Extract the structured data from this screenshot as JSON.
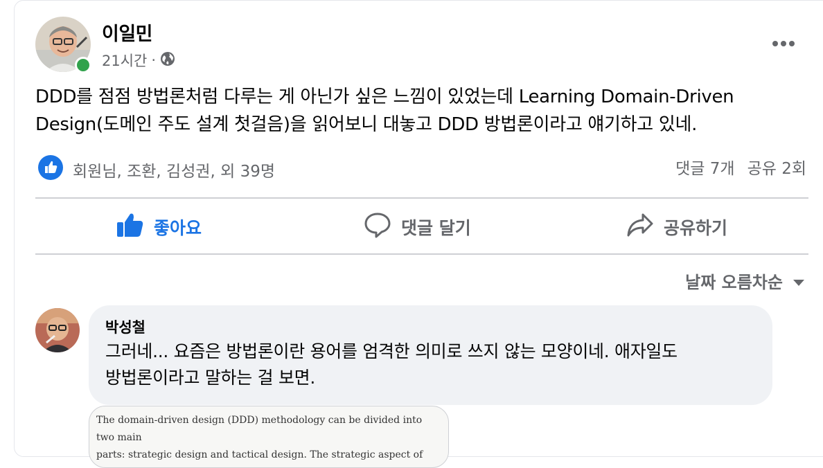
{
  "post": {
    "author": "이일민",
    "time": "21시간",
    "separator": "·",
    "privacy_icon": "globe-icon",
    "more_icon": "more-dots-icon",
    "text_line1": "DDD를 점점 방법론처럼 다루는 게 아닌가 싶은 느낌이 있었는데 Learning Domain-Driven",
    "text_line2": "Design(도메인 주도 설계 첫걸음)을 읽어보니 대놓고 DDD 방법론이라고 얘기하고 있네.",
    "reaction_icon": "like-reaction-icon",
    "reactions_text": "회원님, 조환, 김성권, 외 39명",
    "comments_count": "댓글 7개",
    "shares_count": "공유 2회"
  },
  "actions": {
    "like_label": "좋아요",
    "comment_label": "댓글 달기",
    "share_label": "공유하기"
  },
  "sort": {
    "label": "날짜 오름차순",
    "icon": "caret-down-icon"
  },
  "comment": {
    "author": "박성철",
    "text_line1": "그러네... 요즘은 방법론이란 용어를 엄격한 의미로 쓰지 않는 모양이네. 애자일도",
    "text_line2": "방법론이라고 말하는 걸 보면."
  },
  "attachment": {
    "line1": "The domain-driven design (DDD) methodology can be divided into two main",
    "line2": "parts: strategic design and tactical design. The strategic aspect of DDD deals with"
  },
  "colors": {
    "accent_blue": "#1b74e4",
    "online_green": "#31a24c",
    "secondary_text": "#65676b",
    "bubble_bg": "#f0f2f5"
  }
}
